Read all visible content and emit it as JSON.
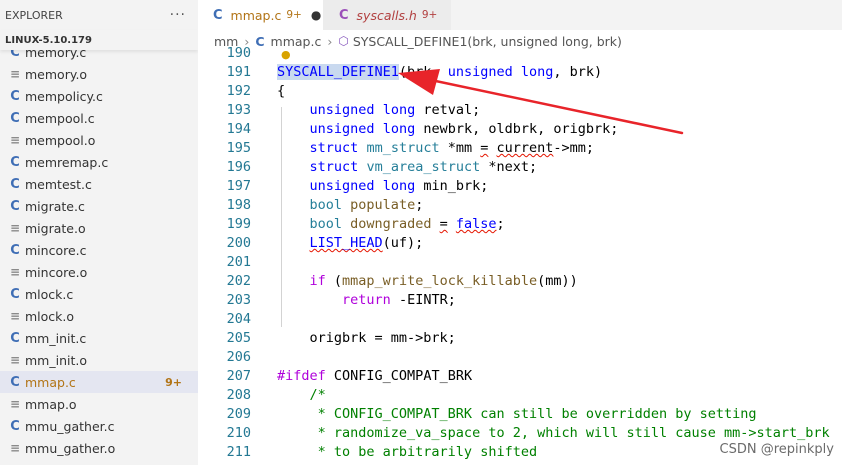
{
  "explorer": {
    "title": "EXPLORER",
    "more": "···",
    "root": "LINUX-5.10.179",
    "files": [
      {
        "type": "c",
        "icon": "C",
        "name": "memory.c",
        "badge": "",
        "active": false
      },
      {
        "type": "o",
        "icon": "≡",
        "name": "memory.o",
        "badge": "",
        "active": false
      },
      {
        "type": "c",
        "icon": "C",
        "name": "mempolicy.c",
        "badge": "",
        "active": false
      },
      {
        "type": "c",
        "icon": "C",
        "name": "mempool.c",
        "badge": "",
        "active": false
      },
      {
        "type": "o",
        "icon": "≡",
        "name": "mempool.o",
        "badge": "",
        "active": false
      },
      {
        "type": "c",
        "icon": "C",
        "name": "memremap.c",
        "badge": "",
        "active": false
      },
      {
        "type": "c",
        "icon": "C",
        "name": "memtest.c",
        "badge": "",
        "active": false
      },
      {
        "type": "c",
        "icon": "C",
        "name": "migrate.c",
        "badge": "",
        "active": false
      },
      {
        "type": "o",
        "icon": "≡",
        "name": "migrate.o",
        "badge": "",
        "active": false
      },
      {
        "type": "c",
        "icon": "C",
        "name": "mincore.c",
        "badge": "",
        "active": false
      },
      {
        "type": "o",
        "icon": "≡",
        "name": "mincore.o",
        "badge": "",
        "active": false
      },
      {
        "type": "c",
        "icon": "C",
        "name": "mlock.c",
        "badge": "",
        "active": false
      },
      {
        "type": "o",
        "icon": "≡",
        "name": "mlock.o",
        "badge": "",
        "active": false
      },
      {
        "type": "c",
        "icon": "C",
        "name": "mm_init.c",
        "badge": "",
        "active": false
      },
      {
        "type": "o",
        "icon": "≡",
        "name": "mm_init.o",
        "badge": "",
        "active": false
      },
      {
        "type": "c",
        "icon": "C",
        "name": "mmap.c",
        "badge": "9+",
        "active": true
      },
      {
        "type": "o",
        "icon": "≡",
        "name": "mmap.o",
        "badge": "",
        "active": false
      },
      {
        "type": "c",
        "icon": "C",
        "name": "mmu_gather.c",
        "badge": "",
        "active": false
      },
      {
        "type": "o",
        "icon": "≡",
        "name": "mmu_gather.o",
        "badge": "",
        "active": false
      }
    ]
  },
  "tabs": [
    {
      "icon": "C",
      "name": "mmap.c",
      "badge": "9+",
      "dirty": "●"
    },
    {
      "icon": "C",
      "name": "syscalls.h",
      "badge": "9+",
      "dirty": ""
    }
  ],
  "breadcrumb": {
    "folder": "mm",
    "sep": "›",
    "file_icon": "C",
    "file": "mmap.c",
    "symbol_icon": "⬡",
    "symbol": "SYSCALL_DEFINE1(brk, unsigned long, brk)"
  },
  "code": {
    "lines": [
      {
        "num": "190",
        "tokens": []
      },
      {
        "num": "191",
        "tokens": [
          [
            "macro hl",
            "SYSCALL_DEFINE1"
          ],
          [
            "",
            "(brk, "
          ],
          [
            "k",
            "unsigned"
          ],
          [
            "",
            " "
          ],
          [
            "k",
            "long"
          ],
          [
            "",
            ", brk)"
          ]
        ]
      },
      {
        "num": "192",
        "tokens": [
          [
            "",
            "{"
          ]
        ]
      },
      {
        "num": "193",
        "tokens": [
          [
            "",
            "    "
          ],
          [
            "k",
            "unsigned"
          ],
          [
            "",
            " "
          ],
          [
            "k",
            "long"
          ],
          [
            "",
            " retval;"
          ]
        ]
      },
      {
        "num": "194",
        "tokens": [
          [
            "",
            "    "
          ],
          [
            "k",
            "unsigned"
          ],
          [
            "",
            " "
          ],
          [
            "k",
            "long"
          ],
          [
            "",
            " newbrk, oldbrk, origbrk;"
          ]
        ]
      },
      {
        "num": "195",
        "tokens": [
          [
            "",
            "    "
          ],
          [
            "k",
            "struct"
          ],
          [
            "",
            " "
          ],
          [
            "ty",
            "mm_struct"
          ],
          [
            "",
            " *mm "
          ],
          [
            "squig",
            "="
          ],
          [
            "",
            " "
          ],
          [
            "squig",
            "current"
          ],
          [
            "",
            "->mm;"
          ]
        ]
      },
      {
        "num": "196",
        "tokens": [
          [
            "",
            "    "
          ],
          [
            "k",
            "struct"
          ],
          [
            "",
            " "
          ],
          [
            "ty",
            "vm_area_struct"
          ],
          [
            "",
            " *next;"
          ]
        ]
      },
      {
        "num": "197",
        "tokens": [
          [
            "",
            "    "
          ],
          [
            "k",
            "unsigned"
          ],
          [
            "",
            " "
          ],
          [
            "k",
            "long"
          ],
          [
            "",
            " min_brk;"
          ]
        ]
      },
      {
        "num": "198",
        "tokens": [
          [
            "",
            "    "
          ],
          [
            "ty",
            "bool"
          ],
          [
            "",
            " "
          ],
          [
            "fn",
            "populate"
          ],
          [
            "",
            ";"
          ]
        ]
      },
      {
        "num": "199",
        "tokens": [
          [
            "",
            "    "
          ],
          [
            "ty",
            "bool"
          ],
          [
            "",
            " "
          ],
          [
            "fn",
            "downgraded"
          ],
          [
            "",
            " "
          ],
          [
            "squig",
            "="
          ],
          [
            "",
            " "
          ],
          [
            "k squig",
            "false"
          ],
          [
            "",
            ";"
          ]
        ]
      },
      {
        "num": "200",
        "tokens": [
          [
            "",
            "    "
          ],
          [
            "macro squig",
            "LIST_HEAD"
          ],
          [
            "",
            "(uf);"
          ]
        ]
      },
      {
        "num": "201",
        "tokens": []
      },
      {
        "num": "202",
        "tokens": [
          [
            "",
            "    "
          ],
          [
            "pp",
            "if"
          ],
          [
            "",
            " ("
          ],
          [
            "fn",
            "mmap_write_lock_killable"
          ],
          [
            "",
            "(mm))"
          ]
        ]
      },
      {
        "num": "203",
        "tokens": [
          [
            "",
            "        "
          ],
          [
            "pp",
            "return"
          ],
          [
            "",
            " -EINTR;"
          ]
        ]
      },
      {
        "num": "204",
        "tokens": []
      },
      {
        "num": "205",
        "tokens": [
          [
            "",
            "    origbrk = mm->brk;"
          ]
        ]
      },
      {
        "num": "206",
        "tokens": []
      },
      {
        "num": "207",
        "tokens": [
          [
            "pp",
            "#ifdef"
          ],
          [
            "",
            " CONFIG_COMPAT_BRK"
          ]
        ]
      },
      {
        "num": "208",
        "tokens": [
          [
            "cm",
            "    /*"
          ]
        ]
      },
      {
        "num": "209",
        "tokens": [
          [
            "cm",
            "     * CONFIG_COMPAT_BRK can still be overridden by setting"
          ]
        ]
      },
      {
        "num": "210",
        "tokens": [
          [
            "cm",
            "     * randomize_va_space to 2, which will still cause mm->start_brk"
          ]
        ]
      },
      {
        "num": "211",
        "tokens": [
          [
            "cm",
            "     * to be arbitrarily shifted"
          ]
        ]
      }
    ]
  },
  "watermark": "CSDN @repinkply",
  "colors": {
    "arrow": "#e8242a",
    "accent": "#3f6eb5",
    "modified": "#b27416"
  }
}
